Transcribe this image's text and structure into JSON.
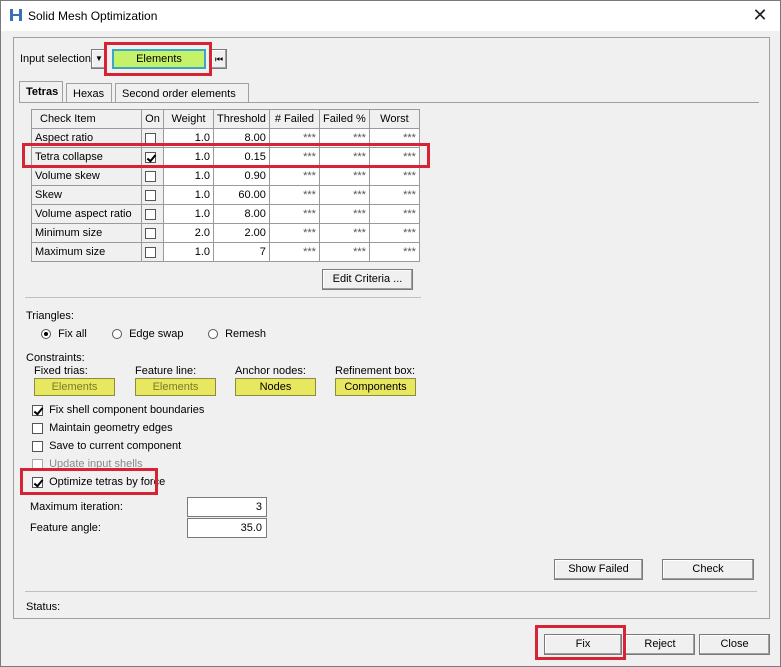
{
  "window": {
    "title": "Solid Mesh Optimization",
    "close_glyph": "✕"
  },
  "input_selection": {
    "label": "Input selection:",
    "dropdown_glyph": "▼",
    "button": "Elements",
    "reset_glyph": "⏮"
  },
  "tabs": [
    {
      "label": "Tetras"
    },
    {
      "label": "Hexas"
    },
    {
      "label": "Second order elements"
    }
  ],
  "table": {
    "headers": [
      "Check Item",
      "On",
      "Weight",
      "Threshold",
      "# Failed",
      "Failed %",
      "Worst"
    ],
    "rows": [
      {
        "item": "Aspect ratio",
        "on": false,
        "weight": "1.0",
        "threshold": "8.00",
        "failed": "***",
        "failed_pct": "***",
        "worst": "***"
      },
      {
        "item": "Tetra collapse",
        "on": true,
        "weight": "1.0",
        "threshold": "0.15",
        "failed": "***",
        "failed_pct": "***",
        "worst": "***"
      },
      {
        "item": "Volume skew",
        "on": false,
        "weight": "1.0",
        "threshold": "0.90",
        "failed": "***",
        "failed_pct": "***",
        "worst": "***"
      },
      {
        "item": "Skew",
        "on": false,
        "weight": "1.0",
        "threshold": "60.00",
        "failed": "***",
        "failed_pct": "***",
        "worst": "***"
      },
      {
        "item": "Volume aspect ratio",
        "on": false,
        "weight": "1.0",
        "threshold": "8.00",
        "failed": "***",
        "failed_pct": "***",
        "worst": "***"
      },
      {
        "item": "Minimum size",
        "on": false,
        "weight": "2.0",
        "threshold": "2.00",
        "failed": "***",
        "failed_pct": "***",
        "worst": "***"
      },
      {
        "item": "Maximum size",
        "on": false,
        "weight": "1.0",
        "threshold": "7",
        "failed": "***",
        "failed_pct": "***",
        "worst": "***"
      }
    ]
  },
  "edit_criteria": "Edit Criteria ...",
  "triangles": {
    "label": "Triangles:",
    "options": [
      {
        "label": "Fix all",
        "selected": true
      },
      {
        "label": "Edge swap",
        "selected": false
      },
      {
        "label": "Remesh",
        "selected": false
      }
    ]
  },
  "constraints": {
    "label": "Constraints:",
    "fixed_trias": {
      "label": "Fixed trias:",
      "button": "Elements"
    },
    "feature_line": {
      "label": "Feature line:",
      "button": "Elements"
    },
    "anchor_nodes": {
      "label": "Anchor nodes:",
      "button": "Nodes"
    },
    "refinement_box": {
      "label": "Refinement box:",
      "button": "Components"
    }
  },
  "checkboxes": [
    {
      "label": "Fix shell component boundaries",
      "checked": true,
      "disabled": false
    },
    {
      "label": "Maintain geometry edges",
      "checked": false,
      "disabled": false
    },
    {
      "label": "Save to current component",
      "checked": false,
      "disabled": false
    },
    {
      "label": "Update input shells",
      "checked": false,
      "disabled": true
    },
    {
      "label": "Optimize tetras by force",
      "checked": true,
      "disabled": false
    }
  ],
  "max_iteration": {
    "label": "Maximum iteration:",
    "value": "3"
  },
  "feature_angle": {
    "label": "Feature angle:",
    "value": "35.0"
  },
  "buttons": {
    "show_failed": "Show Failed",
    "check": "Check",
    "fix": "Fix",
    "reject": "Reject",
    "close": "Close"
  },
  "status": {
    "label": "Status:"
  },
  "colors": {
    "highlight": "#d62434",
    "yellow_button": "#e7e760",
    "elements_button": "#c6f26a"
  }
}
